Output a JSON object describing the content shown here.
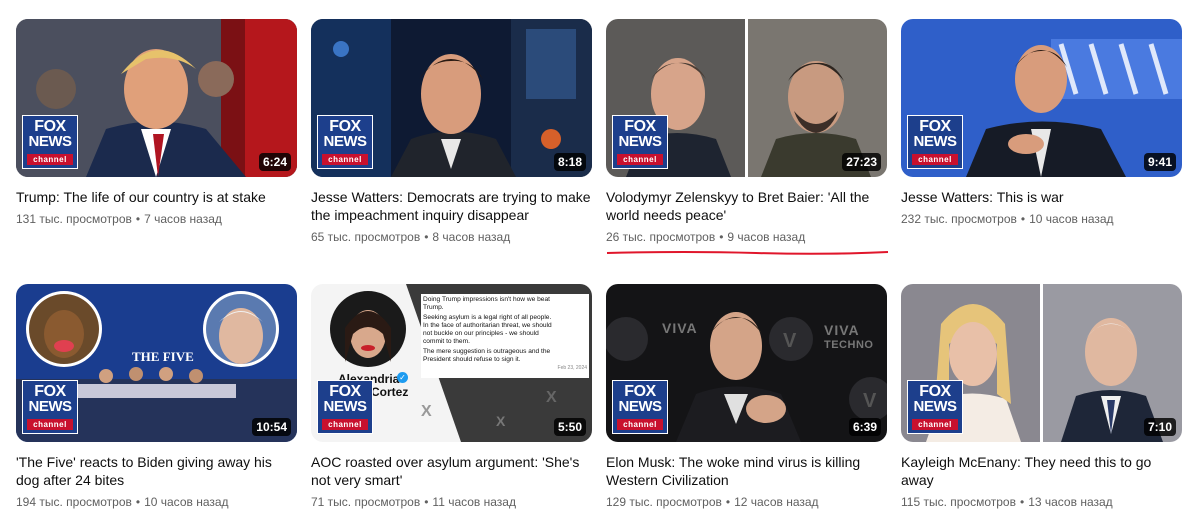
{
  "logo": {
    "fox": "FOX",
    "news": "NEWS",
    "channel": "channel"
  },
  "videos": [
    {
      "title": "Trump: The life of our country is at stake",
      "duration": "6:24",
      "views": "131 тыс. просмотров",
      "age": "7 часов назад"
    },
    {
      "title": "Jesse Watters: Democrats are trying to make the impeachment inquiry disappear",
      "duration": "8:18",
      "views": "65 тыс. просмотров",
      "age": "8 часов назад"
    },
    {
      "title": "Volodymyr Zelenskyy to Bret Baier: 'All the world needs peace'",
      "duration": "27:23",
      "views": "26 тыс. просмотров",
      "age": "9 часов назад"
    },
    {
      "title": "Jesse Watters: This is war",
      "duration": "9:41",
      "views": "232 тыс. просмотров",
      "age": "10 часов назад"
    },
    {
      "title": "'The Five' reacts to Biden giving away his dog after 24 bites",
      "duration": "10:54",
      "views": "194 тыс. просмотров",
      "age": "10 часов назад"
    },
    {
      "title": "AOC roasted over asylum argument: 'She's not very smart'",
      "duration": "5:50",
      "views": "71 тыс. просмотров",
      "age": "11 часов назад"
    },
    {
      "title": "Elon Musk: The woke mind virus is killing Western Civilization",
      "duration": "6:39",
      "views": "129 тыс. просмотров",
      "age": "12 часов назад"
    },
    {
      "title": "Kayleigh McEnany: They need this to go away",
      "duration": "7:10",
      "views": "115 тыс. просмотров",
      "age": "13 часов назад"
    }
  ],
  "thumb_text": {
    "five_banner": "THE FIVE",
    "aoc_name": "Alexandria",
    "aoc_name2": "Cortez",
    "tweet_lines": [
      "Doing Trump impressions isn't how we beat",
      "Trump.",
      "Seeking asylum is a legal right of all people.",
      "In the face of authoritarian threat, we should",
      "not buckle on our principles - we should",
      "commit to them.",
      "The mere suggestion is outrageous and the",
      "President should refuse to sign it."
    ],
    "tweet_date": "Feb 23, 2024",
    "viva": "VIVA",
    "viva_sub": "TECHNO"
  },
  "colors": {
    "fox_blue": "#1d3f8c",
    "fox_red": "#c8102e",
    "underline_red": "#e0162b",
    "meta_gray": "#606060"
  }
}
